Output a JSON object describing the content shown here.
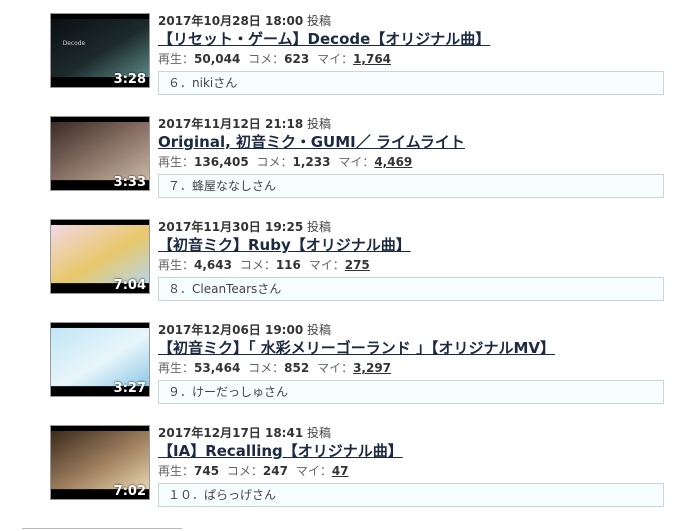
{
  "items": [
    {
      "posted_date": "2017年10月28日 18:00",
      "posted_suffix": "投稿",
      "title": "【リセット・ゲーム】Decode【オリジナル曲】",
      "duration": "3:28",
      "views_label": "再生：",
      "views": "50,044",
      "comments_label": "コメ：",
      "comments": "623",
      "mylist_label": "マイ：",
      "mylist": "1,764",
      "comment_text": "６．nikiさん",
      "thumb_text": "Decode",
      "thumb_colors": [
        "#0b0f12",
        "#1d2a2c",
        "#5c8a86"
      ]
    },
    {
      "posted_date": "2017年11月12日 21:18",
      "posted_suffix": "投稿",
      "title": "Original, 初音ミク・GUMI／ ライムライト",
      "duration": "3:33",
      "views_label": "再生：",
      "views": "136,405",
      "comments_label": "コメ：",
      "comments": "1,233",
      "mylist_label": "マイ：",
      "mylist": "4,469",
      "comment_text": "７．蜂屋ななしさん",
      "thumb_text": "",
      "thumb_colors": [
        "#3a2a26",
        "#8c7468",
        "#c9b8a4"
      ]
    },
    {
      "posted_date": "2017年11月30日 19:25",
      "posted_suffix": "投稿",
      "title": "【初音ミク】Ruby【オリジナル曲】",
      "duration": "7:04",
      "views_label": "再生：",
      "views": "4,643",
      "comments_label": "コメ：",
      "comments": "116",
      "mylist_label": "マイ：",
      "mylist": "275",
      "comment_text": "８．CleanTearsさん",
      "thumb_text": "",
      "thumb_colors": [
        "#f2d9e6",
        "#e8c86a",
        "#b7d4e6"
      ]
    },
    {
      "posted_date": "2017年12月06日 19:00",
      "posted_suffix": "投稿",
      "title": "【初音ミク】「 水彩メリーゴーランド 」【オリジナルMV】",
      "duration": "3:27",
      "views_label": "再生：",
      "views": "53,464",
      "comments_label": "コメ：",
      "comments": "852",
      "mylist_label": "マイ：",
      "mylist": "3,297",
      "comment_text": "９．けーだっしゅさん",
      "thumb_text": "",
      "thumb_colors": [
        "#bfe6f5",
        "#e9f6fb",
        "#8fc8e6"
      ]
    },
    {
      "posted_date": "2017年12月17日 18:41",
      "posted_suffix": "投稿",
      "title": "【IA】Recalling【オリジナル曲】",
      "duration": "7:02",
      "views_label": "再生：",
      "views": "745",
      "comments_label": "コメ：",
      "comments": "247",
      "mylist_label": "マイ：",
      "mylist": "47",
      "comment_text": "１０．ぱらっげさん",
      "thumb_text": "",
      "thumb_colors": [
        "#3a2a1c",
        "#a08060",
        "#e8d6b0"
      ]
    }
  ]
}
